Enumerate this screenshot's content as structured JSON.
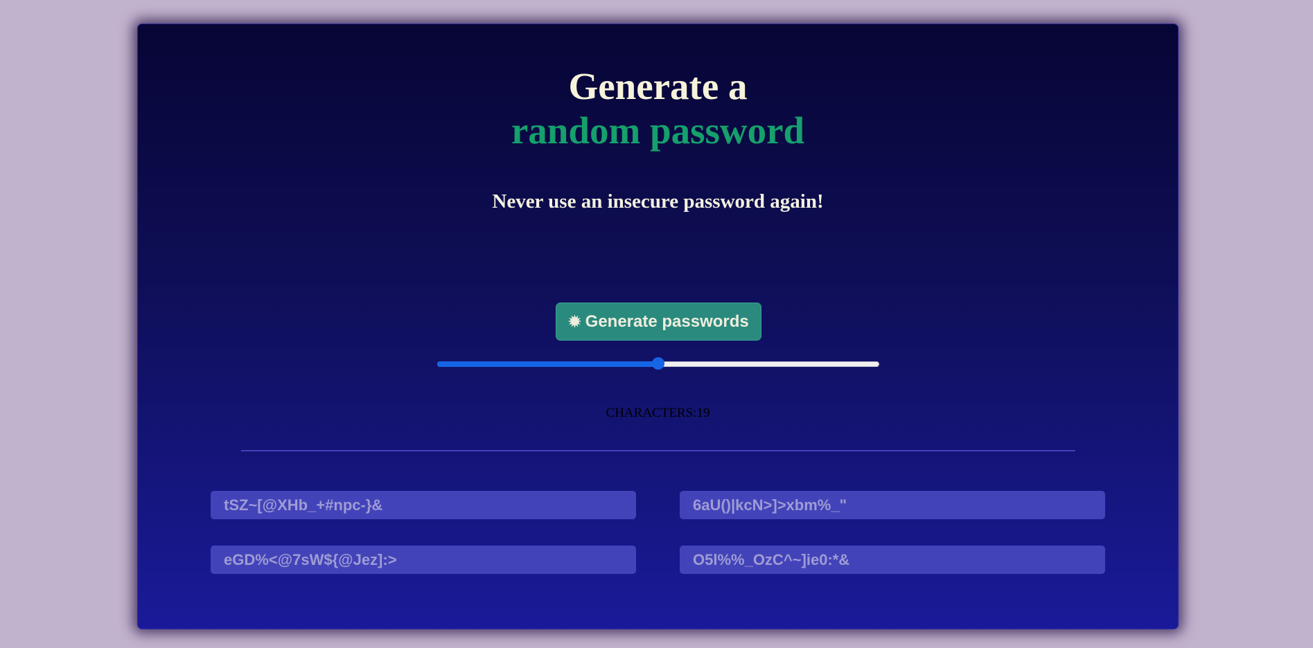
{
  "header": {
    "title_line1": "Generate a",
    "title_line2": "random password",
    "subtitle": "Never use an insecure password again!"
  },
  "generate_button": {
    "icon": "asterisk-icon",
    "icon_glyph": "✹",
    "label": "Generate passwords"
  },
  "length_slider": {
    "value": 19,
    "fraction": 0.5
  },
  "characters_label": "CHARACTERS:19",
  "passwords": [
    "tSZ~[@XHb_+#npc-}&",
    "6aU()|kcN>]>xbm%_\"",
    "eGD%<@7sW${@Jez]:>",
    "O5l%%_OzC^~]ie0:*&"
  ],
  "colors": {
    "page_background": "#c1b2cd",
    "accent_green": "#16a06c",
    "button_background": "#2a8a7e",
    "slider_accent": "#1665e6",
    "password_box": "#4343b9"
  }
}
